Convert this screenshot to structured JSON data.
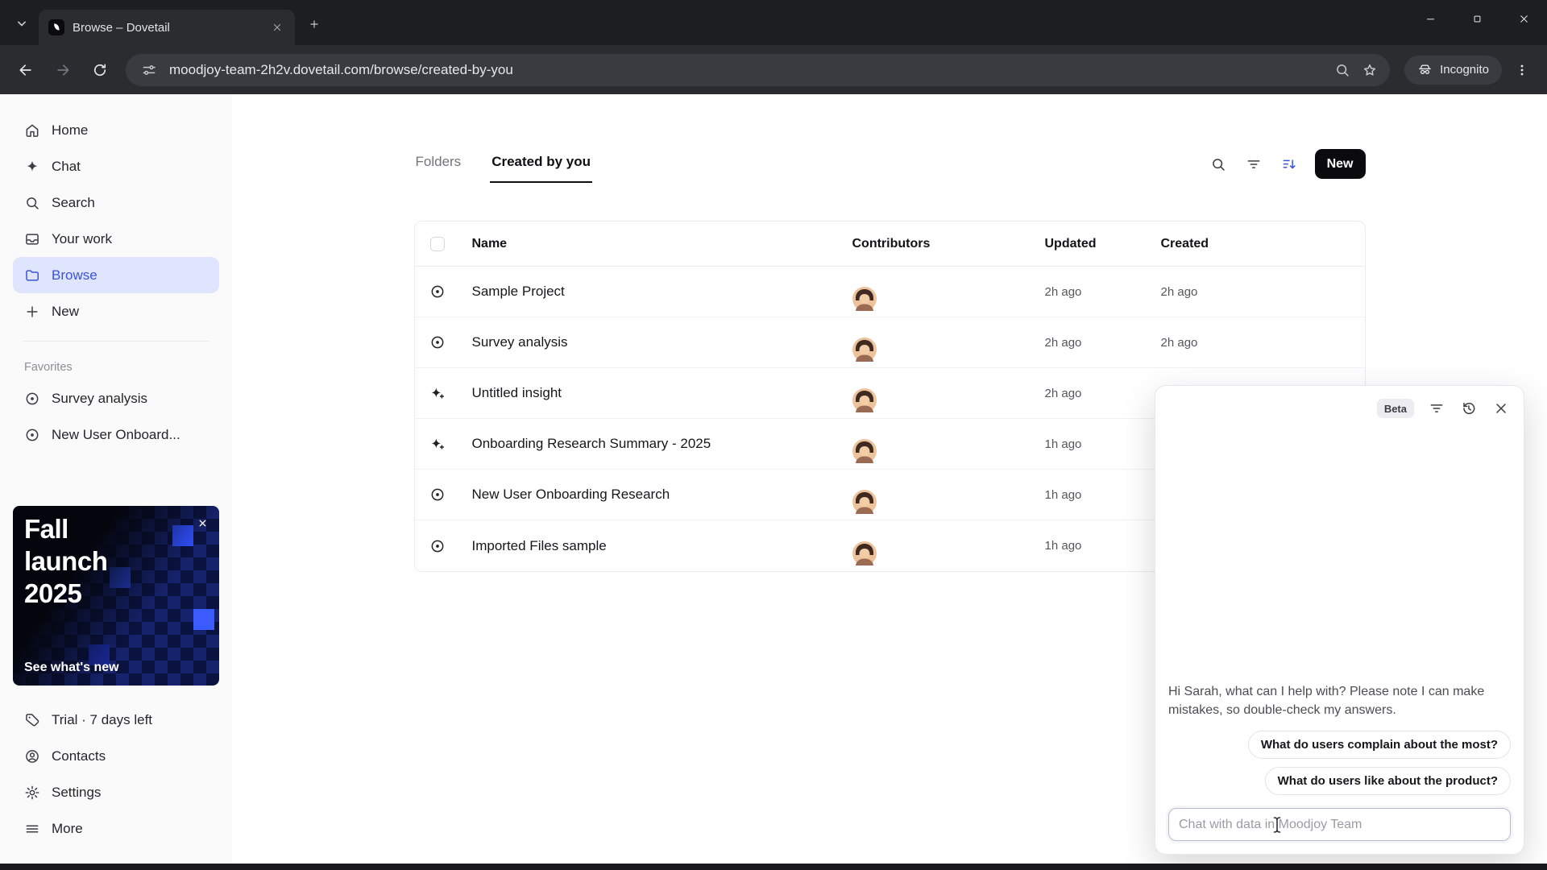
{
  "browser": {
    "tab": {
      "title": "Browse – Dovetail"
    },
    "url": "moodjoy-team-2h2v.dovetail.com/browse/created-by-you",
    "incognito": "Incognito"
  },
  "sidebar": {
    "items": [
      {
        "label": "Home",
        "icon": "home-icon"
      },
      {
        "label": "Chat",
        "icon": "sparkle-icon"
      },
      {
        "label": "Search",
        "icon": "search-icon"
      },
      {
        "label": "Your work",
        "icon": "inbox-icon"
      },
      {
        "label": "Browse",
        "icon": "folder-icon",
        "active": true
      },
      {
        "label": "New",
        "icon": "plus-icon"
      }
    ],
    "favorites_title": "Favorites",
    "favorites": [
      {
        "label": "Survey analysis",
        "icon": "target-icon"
      },
      {
        "label": "New User Onboard...",
        "icon": "target-icon"
      }
    ],
    "promo": {
      "line1": "Fall",
      "line2": "launch",
      "line3": "2025",
      "cta": "See what's new"
    },
    "footer": [
      {
        "label": "Trial · 7 days left",
        "icon": "tag-icon"
      },
      {
        "label": "Contacts",
        "icon": "person-icon"
      },
      {
        "label": "Settings",
        "icon": "gear-icon"
      },
      {
        "label": "More",
        "icon": "menu-icon"
      }
    ]
  },
  "main": {
    "tabs": {
      "folders": "Folders",
      "created": "Created by you"
    },
    "new_button": "New",
    "table": {
      "headers": {
        "name": "Name",
        "contributors": "Contributors",
        "updated": "Updated",
        "created": "Created"
      },
      "rows": [
        {
          "name": "Sample Project",
          "type": "project",
          "updated": "2h ago",
          "created": "2h ago"
        },
        {
          "name": "Survey analysis",
          "type": "project",
          "updated": "2h ago",
          "created": "2h ago"
        },
        {
          "name": "Untitled insight",
          "type": "insight",
          "updated": "2h ago",
          "created": ""
        },
        {
          "name": "Onboarding Research Summary - 2025",
          "type": "insight",
          "updated": "1h ago",
          "created": ""
        },
        {
          "name": "New User Onboarding Research",
          "type": "project",
          "updated": "1h ago",
          "created": ""
        },
        {
          "name": "Imported Files sample",
          "type": "project",
          "updated": "1h ago",
          "created": ""
        }
      ]
    }
  },
  "chat": {
    "beta": "Beta",
    "greeting": "Hi Sarah, what can I help with? Please note I can make mistakes, so double-check my answers.",
    "suggestions": [
      "What do users complain about the most?",
      "What do users like about the product?"
    ],
    "placeholder": "Chat with data in Moodjoy Team"
  }
}
